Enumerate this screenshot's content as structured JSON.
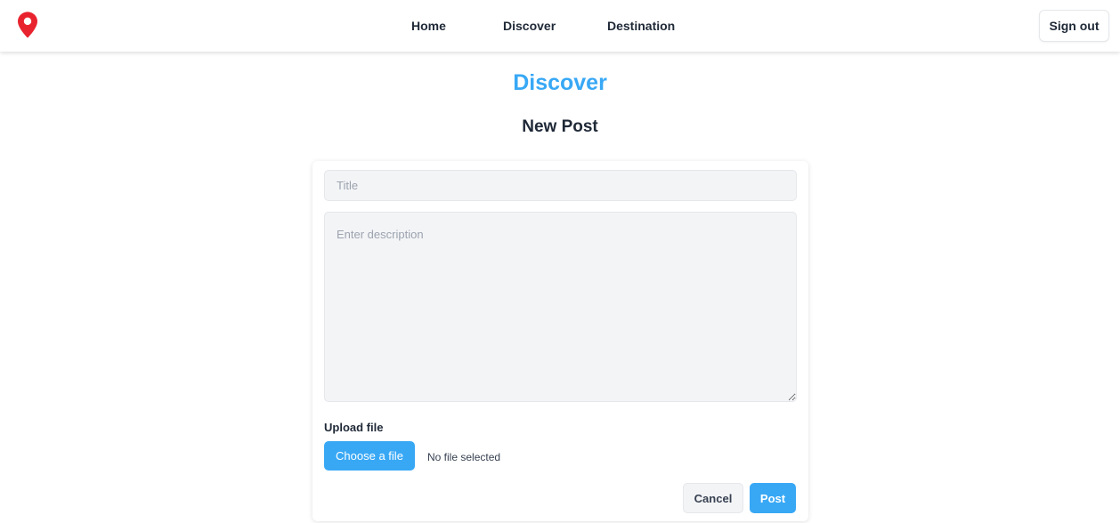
{
  "navbar": {
    "logo_icon": "map-pin-icon",
    "links": [
      {
        "label": "Home"
      },
      {
        "label": "Discover"
      },
      {
        "label": "Destination"
      }
    ],
    "signout_label": "Sign out"
  },
  "page": {
    "title": "Discover",
    "section_title": "New Post"
  },
  "form": {
    "title_placeholder": "Title",
    "title_value": "",
    "description_placeholder": "Enter description",
    "description_value": "",
    "upload_label": "Upload file",
    "choose_file_label": "Choose a file",
    "file_status": "No file selected",
    "cancel_label": "Cancel",
    "post_label": "Post"
  },
  "colors": {
    "accent": "#38a8f5",
    "logo": "#e8232e",
    "text": "#1f2937",
    "input_bg": "#f3f4f6"
  }
}
